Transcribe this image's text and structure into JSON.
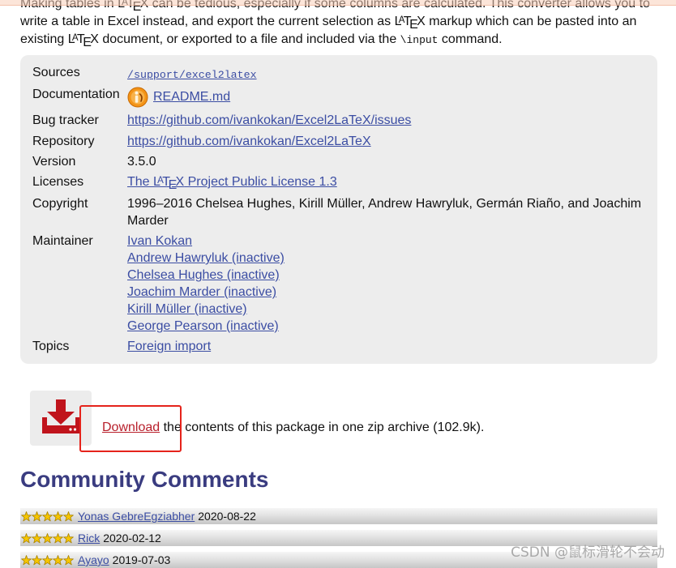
{
  "latex_logo": [
    "L",
    "A",
    "T",
    "E",
    "X"
  ],
  "intro": {
    "l1_before": "Making tables in ",
    "l1_after": " can be tedious, especially if some columns are calculated. This converter allows you to",
    "l2_before": "write a table in Excel instead, and export the current selection as ",
    "l2_after": " markup which can be pasted into an",
    "l3_before": "existing ",
    "l3_middle": " document, or exported to a file and included via the ",
    "l3_code": "\\input",
    "l3_after": " command."
  },
  "info": {
    "sources": {
      "label": "Sources",
      "value": "/support/excel2latex"
    },
    "documentation": {
      "label": "Documentation",
      "value": "README.md",
      "icon": "readme-icon"
    },
    "bug_tracker": {
      "label": "Bug tracker",
      "value": "https://github.com/ivankokan/Excel2LaTeX/issues"
    },
    "repository": {
      "label": "Repository",
      "value": "https://github.com/ivankokan/Excel2LaTeX"
    },
    "version": {
      "label": "Version",
      "value": "3.5.0"
    },
    "licenses": {
      "label": "Licenses",
      "value_before": "The ",
      "value_after": " Project Public License 1.3"
    },
    "copyright": {
      "label": "Copyright",
      "value": "1996–2016 Chelsea Hughes, Kirill Müller, Andrew Hawryluk, Germán Riaño, and Joachim Marder"
    },
    "maintainer": {
      "label": "Maintainer",
      "values": [
        "Ivan Kokan",
        "Andrew Hawryluk (inactive)",
        "Chelsea Hughes (inactive)",
        "Joachim Marder (inactive)",
        "Kirill Müller (inactive)",
        "George Pearson (inactive)"
      ]
    },
    "topics": {
      "label": "Topics",
      "values": [
        "Foreign import"
      ]
    }
  },
  "download": {
    "icon": "download-icon",
    "link_label": "Download",
    "text": " the contents of this package in one zip archive (102.9k)."
  },
  "comments": {
    "title": "Community Comments",
    "rating_scale": 5,
    "items": [
      {
        "rating": 5,
        "name": "Yonas GebreEgziabher",
        "date": "2020-08-22"
      },
      {
        "rating": 5,
        "name": "Rick",
        "date": "2020-02-12"
      },
      {
        "rating": 5,
        "name": "Ayayo",
        "date": "2019-07-03"
      }
    ]
  },
  "watermark": "CSDN @鼠标滑轮不会动",
  "colors": {
    "link": "#3b4da3",
    "download_link": "#b8202c",
    "heading": "#3a3c80",
    "info_box_bg": "#ededed",
    "highlight": "#e5231b",
    "star": "#f7c600"
  }
}
